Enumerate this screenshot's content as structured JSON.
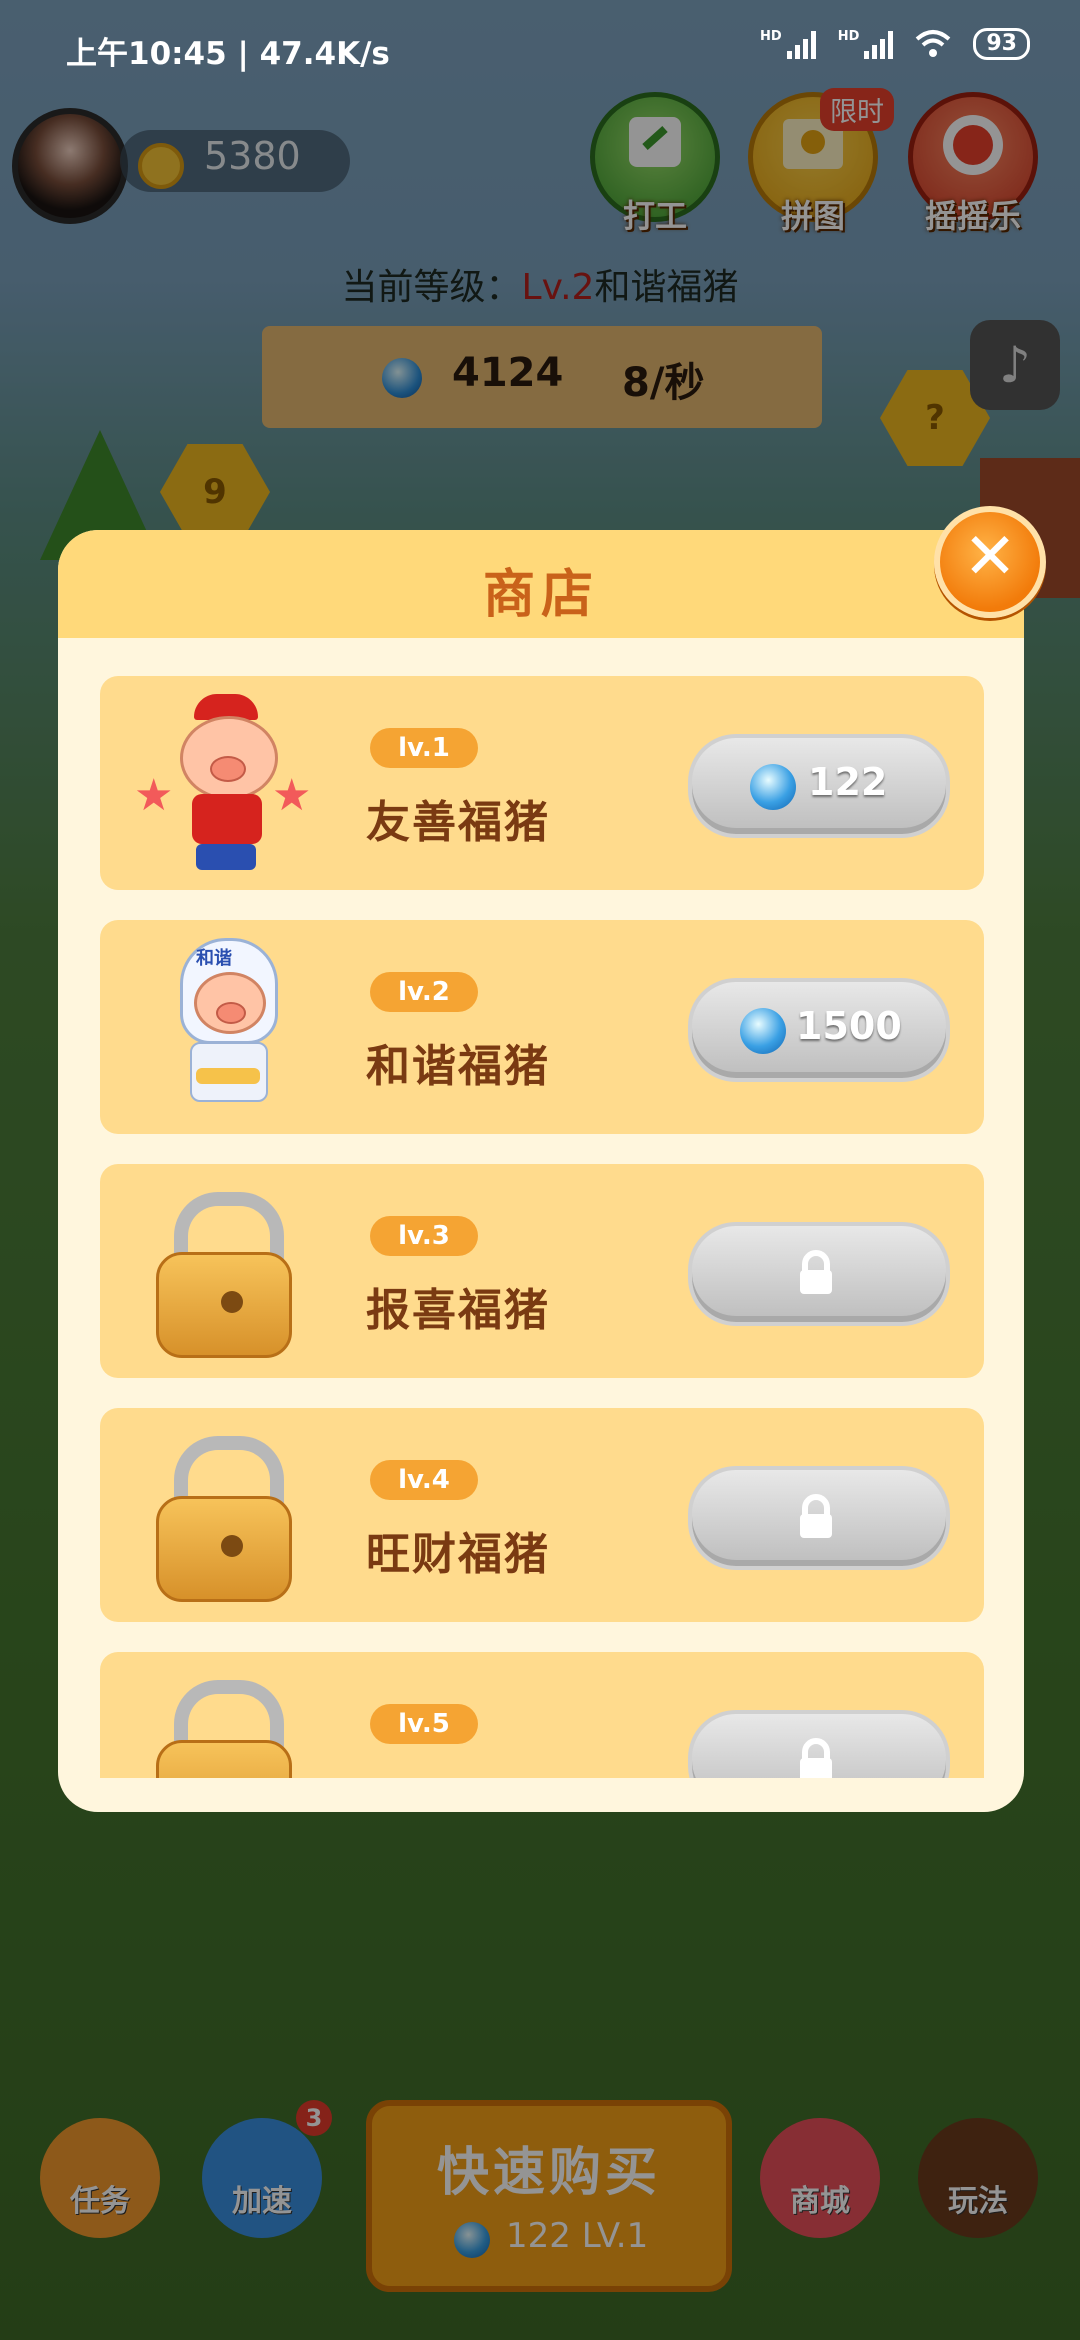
{
  "status_bar": {
    "time_speed": "上午10:45 | 47.4K/s",
    "battery": "93"
  },
  "header": {
    "coins": "5380",
    "buttons": {
      "work": "打工",
      "puzzle": "拼图",
      "puzzle_tag": "限时",
      "shake": "摇摇乐"
    },
    "level_prefix": "当前等级：",
    "level_value": "Lv.2",
    "level_name": "和谐福猪",
    "gems": "4124",
    "rate": "8/秒",
    "hex_left": "9",
    "hex_right": "?"
  },
  "shop": {
    "title": "商店",
    "items": [
      {
        "level": "lv.1",
        "name": "友善福猪",
        "price": "122",
        "locked": false
      },
      {
        "level": "lv.2",
        "name": "和谐福猪",
        "price": "1500",
        "locked": false
      },
      {
        "level": "lv.3",
        "name": "报喜福猪",
        "price": "",
        "locked": true
      },
      {
        "level": "lv.4",
        "name": "旺财福猪",
        "price": "",
        "locked": true
      },
      {
        "level": "lv.5",
        "name": "",
        "price": "",
        "locked": true
      }
    ],
    "pig2_tag": "和谐"
  },
  "bottom_nav": {
    "task": "任务",
    "speed": "加速",
    "speed_badge": "3",
    "quick_buy": "快速购买",
    "quick_price": "122  LV.1",
    "shop": "商城",
    "howto": "玩法"
  },
  "colors": {
    "accent": "#f27b0a",
    "item_bg": "#ffdb8d",
    "modal_bg": "#fff6dd",
    "title": "#c9621a"
  }
}
